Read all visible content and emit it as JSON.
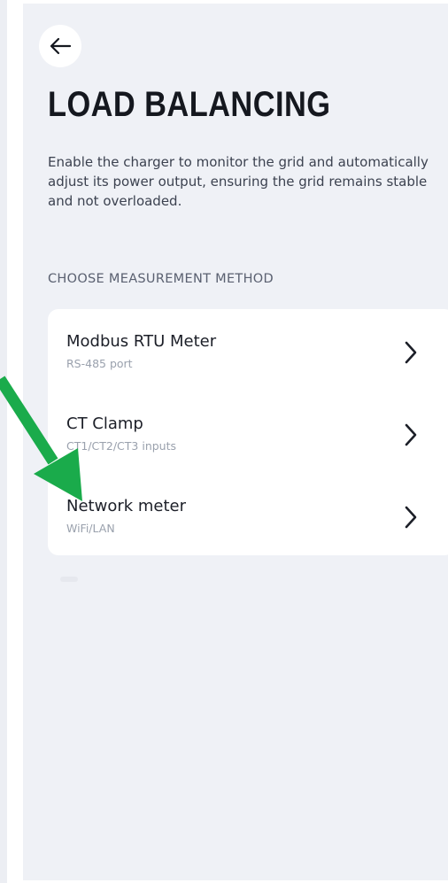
{
  "header": {
    "back_icon": "arrow-left-icon",
    "title": "LOAD BALANCING"
  },
  "description": "Enable the charger to monitor the grid and automatically adjust its power output, ensuring the grid remains stable and not overloaded.",
  "section_label": "CHOOSE MEASUREMENT METHOD",
  "methods": [
    {
      "name": "Modbus RTU Meter",
      "subtitle": "RS-485 port",
      "icon": "chevron-right-icon"
    },
    {
      "name": "CT Clamp",
      "subtitle": "CT1/CT2/CT3 inputs",
      "icon": "chevron-right-icon"
    },
    {
      "name": "Network meter",
      "subtitle": "WiFi/LAN",
      "icon": "chevron-right-icon"
    }
  ],
  "annotation": {
    "icon": "green-pointer-arrow-icon",
    "color": "#1aab4b",
    "points_to": "Network meter"
  },
  "colors": {
    "screen_background": "#eff1f6",
    "card_background": "#ffffff",
    "title_text": "#15181f",
    "secondary_text": "#9aa1ad"
  }
}
